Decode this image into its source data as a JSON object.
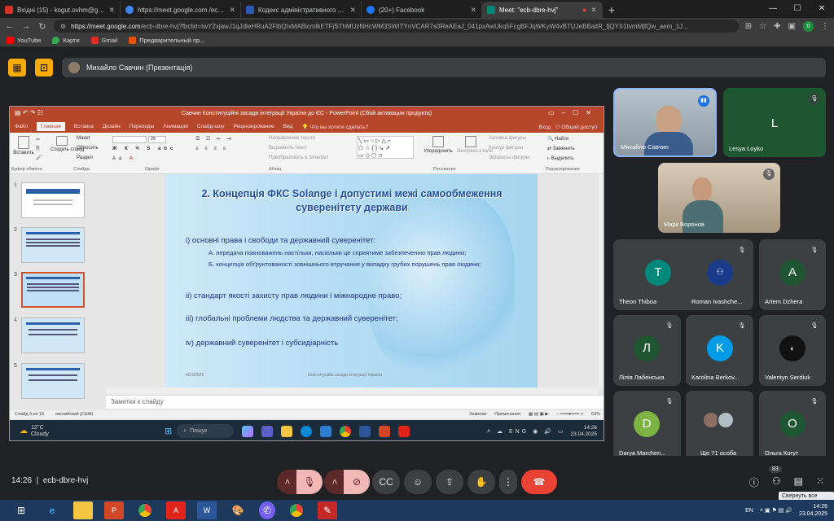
{
  "browser": {
    "tabs": [
      {
        "label": "Вхідні (15) - kogut.ovhm@gmail.co",
        "icon": "gmail-icon",
        "color": "#d93025"
      },
      {
        "label": "https://meet.google.com /ecb-dbre",
        "icon": "google-icon",
        "color": "#4285f4"
      },
      {
        "label": "Кодекс адміністративного суд...",
        "icon": "trident-icon",
        "color": "#2a5ab8"
      },
      {
        "label": "(20+) Facebook",
        "icon": "facebook-icon",
        "color": "#1877f2"
      },
      {
        "label": "Meet: \"ecb-dbre-hvj\"",
        "icon": "meet-icon",
        "color": "#00897b"
      }
    ],
    "url_host": "https://meet.google.com",
    "url_path": "/ecb-dbre-hvj?fbclid=IwY2xjawJ1qJdleHRuA2FlbQIxMABicmlkETFjSThMUzNHcWM3SWITYnVCAR7s0ReAEaJ_041pxAwUkq5FcgBFJqWKyW4vBTUJeBBaitR_fjQYX1tvmMjfQw_aem_1J...",
    "profile_badge": "0",
    "bookmarks": [
      {
        "label": "YouTube",
        "color": "#ff0000"
      },
      {
        "label": "Карти",
        "color": "#34a853"
      },
      {
        "label": "Gmail",
        "color": "#d93025"
      },
      {
        "label": "Предварительный пр...",
        "color": "#e65100"
      }
    ]
  },
  "meet": {
    "presenter_label": "Михайло Савчин (Презентація)",
    "meeting_code": "ecb-dbre-hvj",
    "time": "14:26",
    "people_count": "83",
    "tooltip": "Свернуть все окна",
    "participants": [
      {
        "name": "Михайло Савчин",
        "initial": "",
        "bg": "#7a8a99"
      },
      {
        "name": "Lesya Loyko",
        "initial": "L",
        "bg": "#1e5631"
      },
      {
        "name": "Марк Воронов",
        "initial": "",
        "bg": "#a89a86"
      },
      {
        "name": "Theon Thiboa",
        "initial": "T",
        "bg": "#00897b"
      },
      {
        "name": "Roman Ivashche...",
        "initial": "",
        "bg": "#1a3a8a"
      },
      {
        "name": "Artem Dzhera",
        "initial": "A",
        "bg": "#1e5631"
      },
      {
        "name": "Лілія Лабенська",
        "initial": "Л",
        "bg": "#1e5631"
      },
      {
        "name": "Karolina Berkov...",
        "initial": "K",
        "bg": "#039be5"
      },
      {
        "name": "Valentyn Serdiuk",
        "initial": "",
        "bg": "#111"
      },
      {
        "name": "Darya Marchen...",
        "initial": "D",
        "bg": "#7cb342"
      },
      {
        "name": "Ще 71 особа",
        "initial": "",
        "bg": "#3c4043"
      },
      {
        "name": "Ольга Когут",
        "initial": "O",
        "bg": "#1e5631"
      }
    ]
  },
  "ppt": {
    "title": "Савчин Конституційні засади інтеграції України до ЄС - PowerPoint (Сбой активации продукта)",
    "menu": [
      "Файл",
      "Главная",
      "Вставка",
      "Дизайн",
      "Переходы",
      "Анимация",
      "Слайд-шоу",
      "Рецензирование",
      "Вид",
      "Что вы хотите сделать?"
    ],
    "menu_right": [
      "Вход",
      "Общий доступ"
    ],
    "ribbon": {
      "paste": "Вставить",
      "create_slide": "Создать слайд",
      "layout": "Макет",
      "reset": "Сбросить",
      "section": "Раздел",
      "group_clipboard": "Буфер обмена",
      "group_slides": "Слайды",
      "group_font": "Шрифт",
      "group_paragraph": "Абзац",
      "group_drawing": "Рисование",
      "group_editing": "Редактирование",
      "font_size": "25",
      "text_direction": "Направление текста",
      "align_text": "Выровнять текст",
      "smartart": "Преобразовать в SmartArt",
      "arrange": "Упорядочить",
      "quick_styles": "Экспресс-стили",
      "fill": "Заливка фигуры",
      "outline": "Контур фигуры",
      "effects": "Эффекты фигуры",
      "find": "Найти",
      "replace": "Заменить",
      "select": "Выделить"
    },
    "slide": {
      "title": "2. Концепція ФКС Solange і допустимі межі самообмеження суверенітету держави",
      "items": [
        "i) основні права і свободи та державний суверенітет:",
        "ii) стандарт якості захисту прав людини і міжнародне право;",
        "iii) глобальні проблеми людства та державний суверенітет;",
        "iv) державний суверенітет і субсидіарність"
      ],
      "subitems": [
        "А. передача повноважень настільки, наскільки це сприятиме забезпеченню прав людини;",
        "Б. концепція обґрунтованості зовнішнього втручання у випадку грубих порушень прав людини;"
      ],
      "date": "4/23/2025",
      "footer": "Конституційні засади інтеграції України"
    },
    "thumb_numbers": [
      "1",
      "2",
      "3",
      "4",
      "5"
    ],
    "notes": "Заметки к слайду",
    "status_left": "Слайд 3 из 13",
    "status_lang": "английский (США)",
    "status_notes": "Заметки",
    "status_comments": "Примечания",
    "zoom": "63%",
    "taskbar": {
      "temp": "12°C",
      "weather": "Cloudy",
      "search": "Пошук",
      "lang": "ENG",
      "time": "14:26",
      "date": "23.04.2025"
    }
  },
  "win": {
    "lang": "EN",
    "time": "14:26",
    "date": "23.04.2025"
  }
}
